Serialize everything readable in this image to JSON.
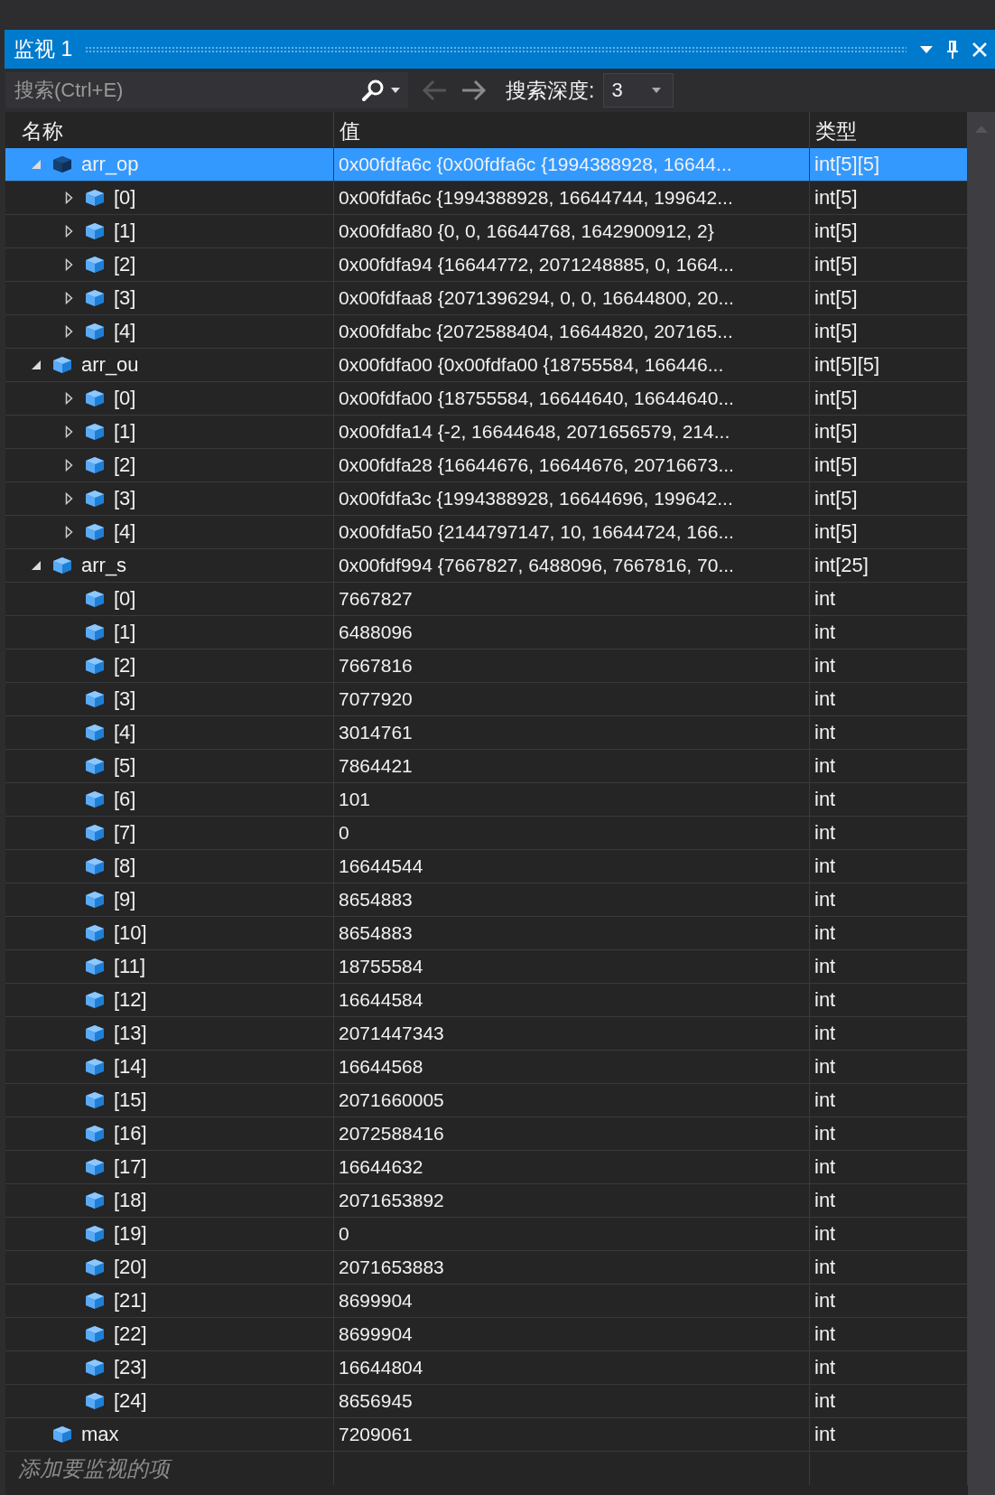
{
  "window": {
    "title": "监视 1"
  },
  "toolbar": {
    "search": {
      "placeholder": "搜索(Ctrl+E)"
    },
    "navigation": [
      {
        "kind": "back",
        "disabled": true
      },
      {
        "kind": "forward",
        "disabled": false
      }
    ],
    "depth_label": "搜索深度:",
    "depth_value": "3"
  },
  "columns": [
    "名称",
    "值",
    "类型"
  ],
  "items": [
    {
      "name": "arr_op",
      "value": "0x00fdfa6c {0x00fdfa6c {1994388928, 16644...",
      "type": "int[5][5]",
      "expanded": true,
      "selected": true,
      "children": [
        {
          "name": "[0]",
          "value": "0x00fdfa6c {1994388928, 16644744, 199642...",
          "type": "int[5]",
          "expanded": false,
          "selected": false
        },
        {
          "name": "[1]",
          "value": "0x00fdfa80 {0, 0, 16644768, 1642900912, 2}",
          "type": "int[5]",
          "expanded": false,
          "selected": false
        },
        {
          "name": "[2]",
          "value": "0x00fdfa94 {16644772, 2071248885, 0, 1664...",
          "type": "int[5]",
          "expanded": false,
          "selected": false
        },
        {
          "name": "[3]",
          "value": "0x00fdfaa8 {2071396294, 0, 0, 16644800, 20...",
          "type": "int[5]",
          "expanded": false,
          "selected": false
        },
        {
          "name": "[4]",
          "value": "0x00fdfabc {2072588404, 16644820, 207165...",
          "type": "int[5]",
          "expanded": false,
          "selected": false
        }
      ]
    },
    {
      "name": "arr_ou",
      "value": "0x00fdfa00 {0x00fdfa00 {18755584, 166446...",
      "type": "int[5][5]",
      "expanded": true,
      "selected": false,
      "children": [
        {
          "name": "[0]",
          "value": "0x00fdfa00 {18755584, 16644640, 16644640...",
          "type": "int[5]",
          "expanded": false,
          "selected": false
        },
        {
          "name": "[1]",
          "value": "0x00fdfa14 {-2, 16644648, 2071656579, 214...",
          "type": "int[5]",
          "expanded": false,
          "selected": false
        },
        {
          "name": "[2]",
          "value": "0x00fdfa28 {16644676, 16644676, 20716673...",
          "type": "int[5]",
          "expanded": false,
          "selected": false
        },
        {
          "name": "[3]",
          "value": "0x00fdfa3c {1994388928, 16644696, 199642...",
          "type": "int[5]",
          "expanded": false,
          "selected": false
        },
        {
          "name": "[4]",
          "value": "0x00fdfa50 {2144797147, 10, 16644724, 166...",
          "type": "int[5]",
          "expanded": false,
          "selected": false
        }
      ]
    },
    {
      "name": "arr_s",
      "value": "0x00fdf994 {7667827, 6488096, 7667816, 70...",
      "type": "int[25]",
      "expanded": true,
      "selected": false,
      "children": [
        {
          "name": "[0]",
          "value": "7667827",
          "type": "int",
          "selected": false
        },
        {
          "name": "[1]",
          "value": "6488096",
          "type": "int",
          "selected": false
        },
        {
          "name": "[2]",
          "value": "7667816",
          "type": "int",
          "selected": false
        },
        {
          "name": "[3]",
          "value": "7077920",
          "type": "int",
          "selected": false
        },
        {
          "name": "[4]",
          "value": "3014761",
          "type": "int",
          "selected": false
        },
        {
          "name": "[5]",
          "value": "7864421",
          "type": "int",
          "selected": false
        },
        {
          "name": "[6]",
          "value": "101",
          "type": "int",
          "selected": false
        },
        {
          "name": "[7]",
          "value": "0",
          "type": "int",
          "selected": false
        },
        {
          "name": "[8]",
          "value": "16644544",
          "type": "int",
          "selected": false
        },
        {
          "name": "[9]",
          "value": "8654883",
          "type": "int",
          "selected": false
        },
        {
          "name": "[10]",
          "value": "8654883",
          "type": "int",
          "selected": false
        },
        {
          "name": "[11]",
          "value": "18755584",
          "type": "int",
          "selected": false
        },
        {
          "name": "[12]",
          "value": "16644584",
          "type": "int",
          "selected": false
        },
        {
          "name": "[13]",
          "value": "2071447343",
          "type": "int",
          "selected": false
        },
        {
          "name": "[14]",
          "value": "16644568",
          "type": "int",
          "selected": false
        },
        {
          "name": "[15]",
          "value": "2071660005",
          "type": "int",
          "selected": false
        },
        {
          "name": "[16]",
          "value": "2072588416",
          "type": "int",
          "selected": false
        },
        {
          "name": "[17]",
          "value": "16644632",
          "type": "int",
          "selected": false
        },
        {
          "name": "[18]",
          "value": "2071653892",
          "type": "int",
          "selected": false
        },
        {
          "name": "[19]",
          "value": "0",
          "type": "int",
          "selected": false
        },
        {
          "name": "[20]",
          "value": "2071653883",
          "type": "int",
          "selected": false
        },
        {
          "name": "[21]",
          "value": "8699904",
          "type": "int",
          "selected": false
        },
        {
          "name": "[22]",
          "value": "8699904",
          "type": "int",
          "selected": false
        },
        {
          "name": "[23]",
          "value": "16644804",
          "type": "int",
          "selected": false
        },
        {
          "name": "[24]",
          "value": "8656945",
          "type": "int",
          "selected": false
        }
      ]
    },
    {
      "name": "max",
      "value": "7209061",
      "type": "int",
      "selected": false
    }
  ],
  "add_row": {
    "placeholder": "添加要监视的项"
  }
}
